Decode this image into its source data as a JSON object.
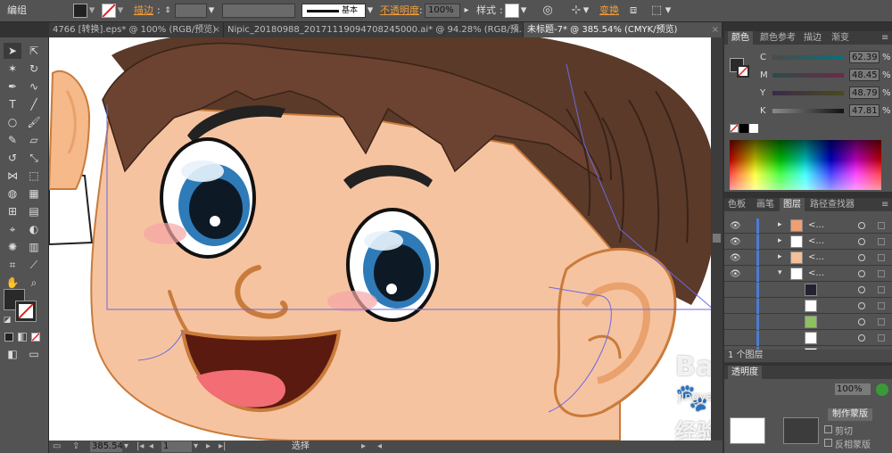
{
  "control_bar": {
    "group_label": "编组",
    "stroke_label": "描边",
    "stroke_value": "",
    "brush_label": "基本",
    "opacity_label": "不透明度",
    "opacity_value": "100%",
    "style_label": "样式",
    "transform_label": "变换"
  },
  "doc_tabs": [
    {
      "label": "4766 [转换].eps* @ 100% (RGB/预览)"
    },
    {
      "label": "Nipic_20180988_20171119094708245000.ai* @ 94.28% (RGB/预..."
    },
    {
      "label": "未标题-7* @ 385.54% (CMYK/预览)",
      "active": true
    }
  ],
  "status_bar": {
    "zoom": "385.54",
    "page": "1",
    "tool": "选择"
  },
  "color_panel": {
    "tabs": [
      "颜色",
      "颜色参考",
      "描边",
      "渐变"
    ],
    "channels": [
      {
        "name": "C",
        "value": "62.39",
        "unit": "%"
      },
      {
        "name": "M",
        "value": "48.45",
        "unit": "%"
      },
      {
        "name": "Y",
        "value": "48.79",
        "unit": "%"
      },
      {
        "name": "K",
        "value": "47.81",
        "unit": "%"
      }
    ]
  },
  "layers_panel": {
    "tabs": [
      "色板",
      "画笔",
      "图层",
      "路径查找器"
    ],
    "layer_name": "<...",
    "footer": "1 个图层"
  },
  "transparency_panel": {
    "tab": "透明度",
    "opacity": "100%",
    "make_mask": "制作蒙版",
    "clip": "剪切",
    "invert_mask": "反相蒙版"
  },
  "watermark": {
    "brand": "Bai",
    "brand2": "经验",
    "url": "jingyan.baidu.com"
  },
  "colors": {
    "skin": "#f6c3a0",
    "skin_shadow": "#e9a16d",
    "hair": "#5b3a2a",
    "hair_dark": "#3a2318",
    "outline": "#c97b3b",
    "eye_blue": "#2e7bb8",
    "mouth": "#5a1a10",
    "tongue": "#f26d74",
    "blush": "#f7a5a5"
  }
}
